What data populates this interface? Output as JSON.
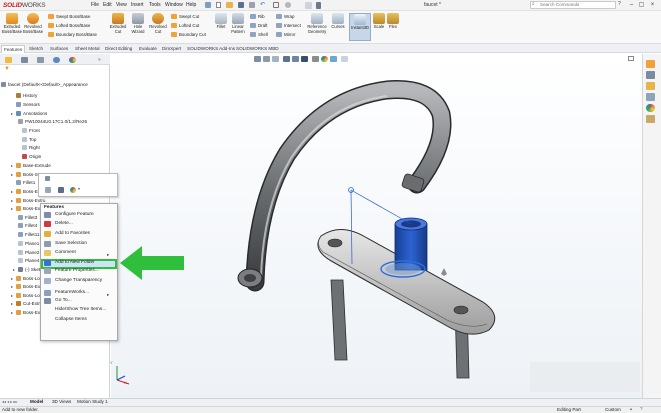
{
  "app": {
    "logo_brand": "SOLID",
    "logo_works": "WORKS",
    "doc_title": "faucet *",
    "menu": [
      "File",
      "Edit",
      "View",
      "Insert",
      "Tools",
      "Window",
      "Help"
    ],
    "search_placeholder": "Search Commands"
  },
  "ribbon": {
    "big": [
      {
        "label": "Extruded Boss/Base"
      },
      {
        "label": "Revolved Boss/Base"
      },
      {
        "label": "Extruded Cut"
      },
      {
        "label": "Hole Wizard"
      },
      {
        "label": "Revolved Cut"
      },
      {
        "label": "Fillet"
      },
      {
        "label": "Linear Pattern"
      },
      {
        "label": "Reference Geometry"
      },
      {
        "label": "Curves"
      },
      {
        "label": "Instant3D"
      },
      {
        "label": "Scale"
      },
      {
        "label": "Flex"
      }
    ],
    "small": [
      {
        "label": "Swept Boss/Base"
      },
      {
        "label": "Lofted Boss/Base"
      },
      {
        "label": "Boundary Boss/Base"
      },
      {
        "label": "Swept Cut"
      },
      {
        "label": "Lofted Cut"
      },
      {
        "label": "Boundary Cut"
      },
      {
        "label": "Rib"
      },
      {
        "label": "Draft"
      },
      {
        "label": "Shell"
      },
      {
        "label": "Wrap"
      },
      {
        "label": "Intersect"
      },
      {
        "label": "Mirror"
      }
    ],
    "tabs": [
      "Features",
      "Sketch",
      "Surfaces",
      "Sheet Metal",
      "Direct Editing",
      "Evaluate",
      "DimXpert",
      "SOLIDWORKS Add-Ins",
      "SOLIDWORKS MBD"
    ]
  },
  "tree": {
    "items": [
      {
        "label": "faucet (Default<<Default>_Appearance"
      },
      {
        "label": "History"
      },
      {
        "label": "Sensors"
      },
      {
        "label": "Annotations"
      },
      {
        "label": "PW10044U0.17C1.0/1.2/Re26"
      },
      {
        "label": "Front"
      },
      {
        "label": "Top"
      },
      {
        "label": "Right"
      },
      {
        "label": "Origin"
      },
      {
        "label": "Base-Extrude"
      },
      {
        "label": "Boss-Swee"
      },
      {
        "label": "Fillet1"
      },
      {
        "label": "Boss-Extru"
      },
      {
        "label": "Boss-Extru"
      },
      {
        "label": "Boss-Extru"
      },
      {
        "label": "Fillet3"
      },
      {
        "label": "Fillet4"
      },
      {
        "label": "Fillet11"
      },
      {
        "label": "Plane1"
      },
      {
        "label": "Plane2"
      },
      {
        "label": "Plane4"
      },
      {
        "label": "(-) Sketch"
      },
      {
        "label": "Boss-Loft1"
      },
      {
        "label": "Boss-Extru"
      },
      {
        "label": "Boss-Loft"
      },
      {
        "label": "Cut-Extru"
      },
      {
        "label": "Boss-Extru"
      }
    ]
  },
  "context_menu": {
    "header": "Features",
    "items": [
      {
        "label": "Configure Feature"
      },
      {
        "label": "Delete..."
      },
      {
        "label": "Add to Favorites"
      },
      {
        "label": "Save Selection"
      },
      {
        "label": "Comment"
      },
      {
        "label": "Add to New Folder"
      },
      {
        "label": "Feature Properties..."
      },
      {
        "label": "Change Transparency"
      },
      {
        "label": "FeatureWorks..."
      },
      {
        "label": "Go To..."
      },
      {
        "label": "Hide/Show Tree Items..."
      },
      {
        "label": "Collapse Items"
      }
    ]
  },
  "highlighted_item": "Add to New Folder",
  "bottom_tabs": [
    "Model",
    "3D Views",
    "Motion Study 1"
  ],
  "status": {
    "left": "Add to new folder.",
    "mode": "Editing Part",
    "units": "Custom"
  },
  "colors": {
    "accent": "#2fbf3c",
    "selection": "#1e5bd6",
    "part": "#1c4fb8",
    "brand": "#cc1f1f"
  }
}
